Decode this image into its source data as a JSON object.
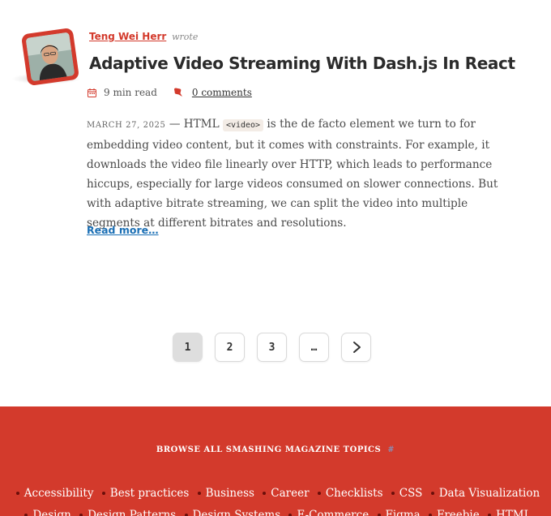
{
  "article": {
    "author": "Teng Wei Herr",
    "author_suffix": "wrote",
    "title": "Adaptive Video Streaming With Dash.js In React",
    "read_time": "9 min read",
    "comments": "0 comments",
    "date": "March 27, 2025",
    "date_separator": "—",
    "excerpt_before_code": "HTML",
    "excerpt_code": "<video>",
    "excerpt_after_code": "is the de facto element we turn to for embedding video content, but it comes with constraints. For example, it downloads the video file linearly over HTTP, which leads to performance hiccups, especially for large videos consumed on slower connections. But with adaptive bitrate streaming, we can split the video into multiple segments at different bitrates and resolutions.",
    "read_more": "Read more…",
    "icons": {
      "date": "calendar-icon",
      "comments": "comment-icon",
      "avatar": "author-photo"
    }
  },
  "pagination": {
    "pages": [
      "1",
      "2",
      "3",
      "…"
    ],
    "current": 1,
    "next_icon": "chevron-right-icon"
  },
  "footer": {
    "heading": "Browse all Smashing Magazine Topics",
    "heading_link": "#",
    "topics_row1": [
      "Accessibility",
      "Best practices",
      "Business",
      "Career",
      "Checklists",
      "CSS",
      "Data Visualization"
    ],
    "topics_row2": [
      "Design",
      "Design Patterns",
      "Design Systems",
      "E-Commerce",
      "Figma",
      "Freebie",
      "HTML"
    ]
  },
  "colors": {
    "brand_red": "#d33a2c",
    "link_blue": "#1a6fb5",
    "title_text": "#2b2b2b",
    "footer_bullet": "#6b0f0a"
  }
}
